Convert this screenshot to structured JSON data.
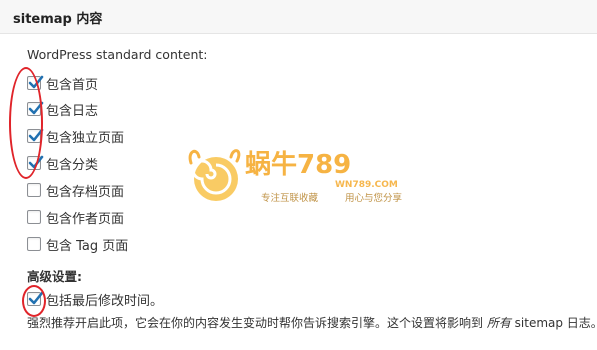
{
  "panel": {
    "title": "sitemap 内容"
  },
  "standard_content": {
    "label": "WordPress standard content:",
    "options": [
      {
        "label": "包含首页",
        "checked": true
      },
      {
        "label": "包含日志",
        "checked": true
      },
      {
        "label": "包含独立页面",
        "checked": true
      },
      {
        "label": "包含分类",
        "checked": true
      },
      {
        "label": "包含存档页面",
        "checked": false
      },
      {
        "label": "包含作者页面",
        "checked": false
      },
      {
        "label": "包含 Tag 页面",
        "checked": false
      }
    ]
  },
  "advanced": {
    "label": "高级设置:",
    "option": {
      "label": "包括最后修改时间。",
      "checked": true
    },
    "hint_before": "强烈推荐开启此项，它会在你的内容发生变动时帮你告诉搜索引擎。这个设置将影响到 ",
    "hint_em": "所有",
    "hint_after": " sitemap 日志。"
  },
  "watermark": {
    "logo_text": "蜗牛789",
    "domain": "WN789.COM",
    "slogan_left": "专注互联收藏",
    "slogan_right": "用心与您分享"
  },
  "colors": {
    "annotation_red": "#e0242a",
    "check_blue": "#2271b1",
    "watermark_orange": "#f5a623"
  }
}
